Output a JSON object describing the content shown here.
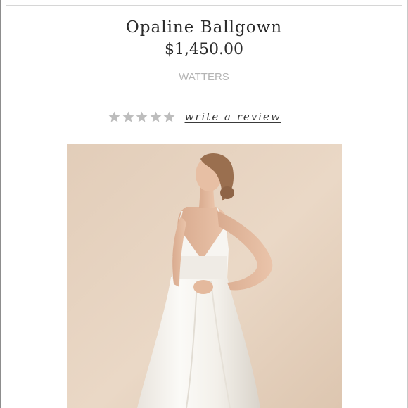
{
  "product": {
    "title": "Opaline Ballgown",
    "price": "$1,450.00",
    "brand": "WATTERS"
  },
  "rating": {
    "stars_filled": 0,
    "stars_total": 5,
    "star_color": "#bdbdbd",
    "review_link_label": "write a review"
  },
  "photo": {
    "subject": "model in white satin ballgown",
    "background_color": "#e6d2bf"
  }
}
